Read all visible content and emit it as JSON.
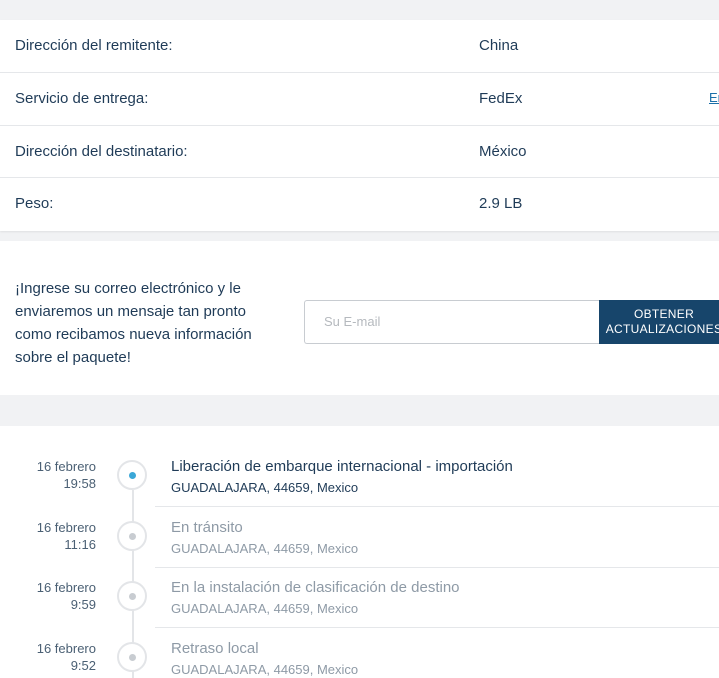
{
  "shipment_info": {
    "rows": [
      {
        "label": "Dirección del remitente:",
        "value": "China"
      },
      {
        "label": "Servicio de entrega:",
        "value": "FedEx",
        "edge_link": "Er"
      },
      {
        "label": "Dirección del destinatario:",
        "value": "México"
      },
      {
        "label": "Peso:",
        "value": "2.9 LB"
      }
    ]
  },
  "subscribe": {
    "message": "¡Ingrese su correo electrónico y le enviaremos un mensaje tan pronto como recibamos nueva información sobre el paquete!",
    "email_placeholder": "Su E-mail",
    "button_line1": "OBTENER",
    "button_line2": "ACTUALIZACIONES"
  },
  "tracking": {
    "events": [
      {
        "date": "16 febrero",
        "time": "19:58",
        "title": "Liberación de embarque internacional - importación",
        "location": "GUADALAJARA, 44659, Mexico",
        "active": true
      },
      {
        "date": "16 febrero",
        "time": "11:16",
        "title": "En tránsito",
        "location": "GUADALAJARA, 44659, Mexico",
        "active": false
      },
      {
        "date": "16 febrero",
        "time": "9:59",
        "title": "En la instalación de clasificación de destino",
        "location": "GUADALAJARA, 44659, Mexico",
        "active": false
      },
      {
        "date": "16 febrero",
        "time": "9:52",
        "title": "Retraso local",
        "location": "GUADALAJARA, 44659, Mexico",
        "active": false
      }
    ]
  },
  "colors": {
    "accent_button": "#17456b",
    "active_dot": "#3ba7d7",
    "link": "#1b6fa8"
  }
}
